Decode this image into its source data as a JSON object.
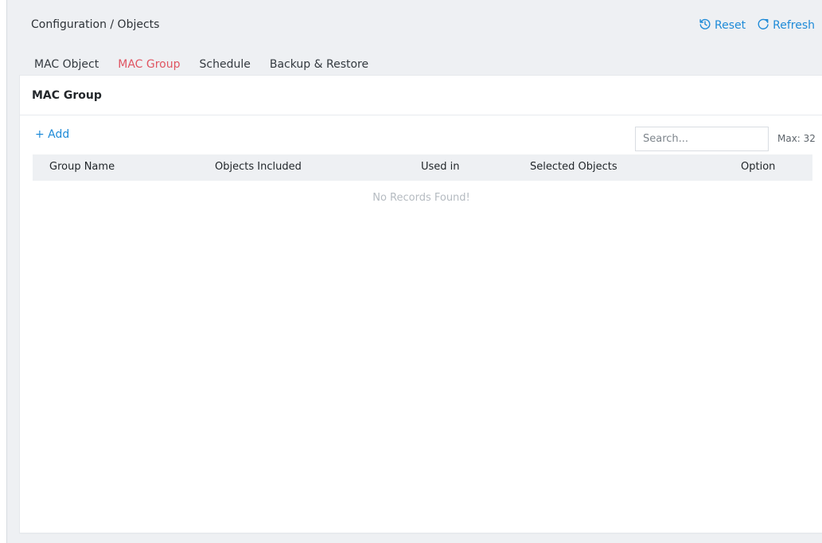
{
  "breadcrumb": "Configuration / Objects",
  "actions": {
    "reset": "Reset",
    "refresh": "Refresh"
  },
  "tabs": [
    {
      "label": "MAC Object",
      "active": false
    },
    {
      "label": "MAC Group",
      "active": true
    },
    {
      "label": "Schedule",
      "active": false
    },
    {
      "label": "Backup & Restore",
      "active": false
    }
  ],
  "panel": {
    "title": "MAC Group",
    "add_label": "+ Add",
    "search_placeholder": "Search...",
    "max_label": "Max: 32",
    "columns": [
      "Group Name",
      "Objects Included",
      "Used in",
      "Selected Objects",
      "Option"
    ],
    "empty_text": "No Records Found!"
  },
  "colors": {
    "accent": "#1f8bd8",
    "active_tab": "#e05562",
    "background": "#eef0f3"
  },
  "icons": {
    "reset": "reset-icon",
    "refresh": "refresh-icon"
  }
}
